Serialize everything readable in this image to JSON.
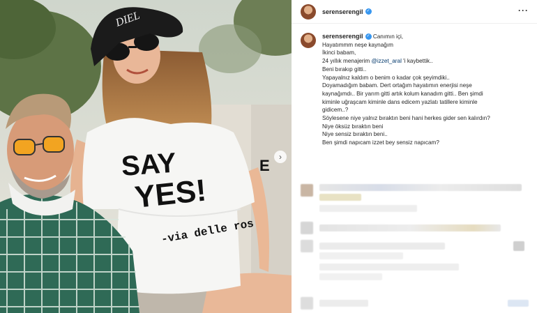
{
  "post": {
    "username": "serenserengil",
    "shirt_print": {
      "line1": "SAY",
      "line2": "YES!",
      "line3": "-via delle ros",
      "sleeve": "E"
    },
    "hat_print": "DIEL"
  },
  "caption": {
    "first_line": "Canımın içi,",
    "mention": "@izzet_aral",
    "lines": [
      "Hayatımmm neşe kaynağım",
      "İkinci babam,",
      "24 yıllık menajerim ",
      "Beni bırakıp gitti..",
      "Yapayalnız kaldım o benim o kadar çok şeyimdiki..",
      "Doyamadığım babam. Dert ortağım hayatımın enerjisi neşe",
      "kaynağımdı.. Bir yarım gitti artık kolum kanadım gitti.. Ben şimdi",
      "kiminle uğraşcam kiminle dans edicem yazlatı tatillere kiminle",
      "gidicem..?",
      "Söylesene niye yalnız bıraktın beni hani herkes gider sen kalırdın?",
      "Niye öksüz bıraktın beni",
      "Niye sensiz bıraktın beni..",
      "Ben şimdi napıcam izzet bey sensiz napıcam?"
    ],
    "after_mention": " 'i kaybettik.."
  },
  "icons": {
    "verified": "verified-badge-icon",
    "more": "more-options-icon",
    "carousel": "chevron-right-icon"
  },
  "colors": {
    "verified_blue": "#3897f0",
    "mention": "#00376b",
    "text": "#262626"
  }
}
